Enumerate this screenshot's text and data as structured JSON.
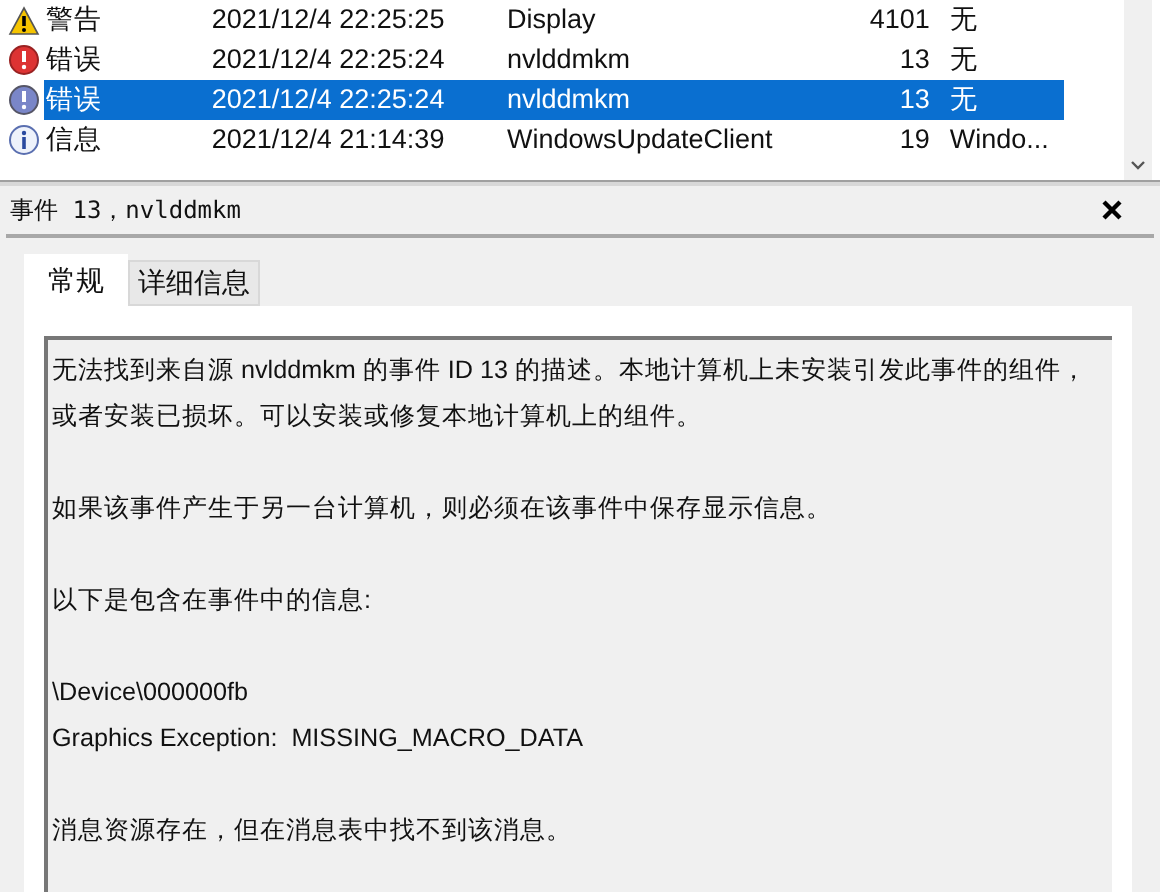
{
  "events": [
    {
      "kind": "warning",
      "level": "警告",
      "date": "2021/12/4 22:25:25",
      "source": "Display",
      "id": "4101",
      "task": "无",
      "selected": false
    },
    {
      "kind": "error",
      "level": "错误",
      "date": "2021/12/4 22:25:24",
      "source": "nvlddmkm",
      "id": "13",
      "task": "无",
      "selected": false
    },
    {
      "kind": "error",
      "level": "错误",
      "date": "2021/12/4 22:25:24",
      "source": "nvlddmkm",
      "id": "13",
      "task": "无",
      "selected": true
    },
    {
      "kind": "info",
      "level": "信息",
      "date": "2021/12/4 21:14:39",
      "source": "WindowsUpdateClient",
      "id": "19",
      "task": "Windo...",
      "selected": false
    }
  ],
  "detail": {
    "title": "事件 13，nvlddmkm",
    "tabs": [
      {
        "label": "常规",
        "selected": true
      },
      {
        "label": "详细信息",
        "selected": false
      }
    ],
    "paragraphs": [
      [
        "无法找到来自源 nvlddmkm 的事件 ID 13 的描述。本地计算机上未安装引发此事件的组件，或者安装已损坏。可以安装或修复本地计算机上的组件。"
      ],
      [
        "如果该事件产生于另一台计算机，则必须在该事件中保存显示信息。"
      ],
      [
        "以下是包含在事件中的信息:"
      ],
      [
        "\\Device\\000000fb",
        "Graphics Exception:  MISSING_MACRO_DATA"
      ],
      [
        "消息资源存在，但在消息表中找不到该消息。"
      ]
    ]
  }
}
